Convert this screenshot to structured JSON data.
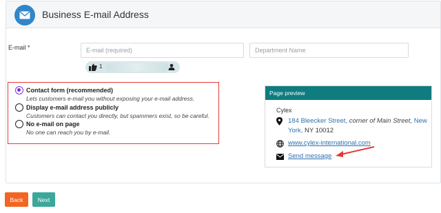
{
  "header": {
    "title": "Business E-mail Address",
    "icon": "envelope-icon"
  },
  "form": {
    "email_label": "E-mail *",
    "email_placeholder": "E-mail (required)",
    "email_value": "",
    "department_placeholder": "Department Name",
    "department_value": "",
    "feedback_count": "1"
  },
  "options": [
    {
      "title": "Contact form (recommended)",
      "desc": "Lets customers e-mail you without exposing your e-mail address.",
      "checked": true
    },
    {
      "title": "Display e-mail address publicly",
      "desc": "Customers can contact you directly, but spammers exist, so be careful.",
      "checked": false
    },
    {
      "title": "No e-mail on page",
      "desc": "No one can reach you by e-mail.",
      "checked": false
    }
  ],
  "preview": {
    "header": "Page preview",
    "company": "Cylex",
    "street": "184 Bleecker Street,",
    "corner": "corner of Main Street,",
    "city": "New York,",
    "state_zip": "NY 10012",
    "website": "www.cylex-international.com",
    "send_message": "Send message"
  },
  "buttons": {
    "back": "Back",
    "next": "Next"
  },
  "colors": {
    "accent": "#0f7c7f",
    "back_button": "#f26522",
    "next_button": "#3aa89a",
    "highlight_border": "#e53935",
    "radio_checked": "#7b2ce0",
    "link": "#2f6fb1"
  }
}
